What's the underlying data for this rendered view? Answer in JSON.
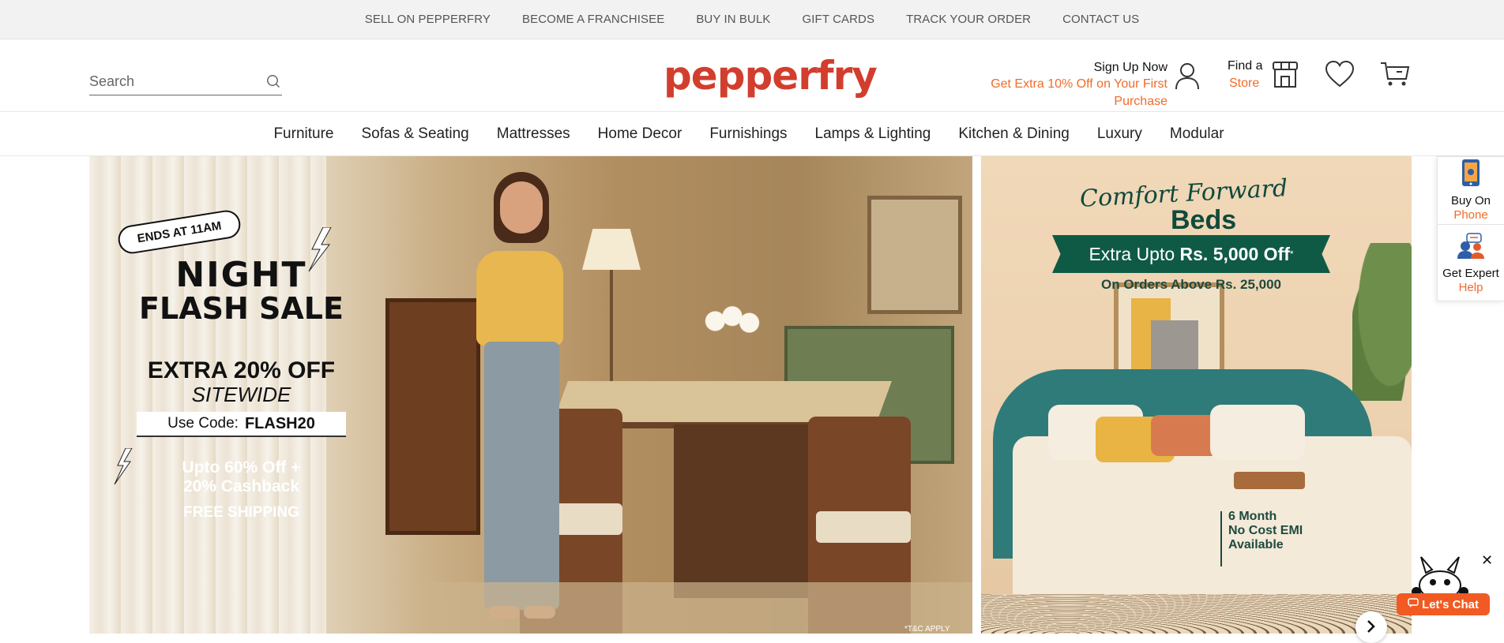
{
  "topbar": {
    "links": [
      "SELL ON PEPPERFRY",
      "BECOME A FRANCHISEE",
      "BUY IN BULK",
      "GIFT CARDS",
      "TRACK YOUR ORDER",
      "CONTACT US"
    ]
  },
  "header": {
    "search_placeholder": "Search",
    "logo": "pepperfry",
    "signup_title": "Sign Up Now",
    "signup_offer": "Get Extra 10% Off on Your First Purchase",
    "store_line1": "Find a",
    "store_line2": "Store"
  },
  "nav": {
    "items": [
      "Furniture",
      "Sofas & Seating",
      "Mattresses",
      "Home Decor",
      "Furnishings",
      "Lamps & Lighting",
      "Kitchen & Dining",
      "Luxury",
      "Modular"
    ]
  },
  "banner_left": {
    "badge": "ENDS AT 11AM",
    "title_line1": "NIGHT",
    "title_line2": "FLASH SALE",
    "offer": "EXTRA 20% OFF",
    "offer_sub": "SITEWIDE",
    "code_label": "Use Code:",
    "code": "FLASH20",
    "line1": "Upto 60% Off +",
    "line2": "20% Cashback",
    "shipping": "FREE SHIPPING",
    "tnc": "*T&C APPLY"
  },
  "banner_right": {
    "script": "Comfort Forward",
    "title": "Beds",
    "offer_prefix": "Extra Upto ",
    "offer_amount": "Rs. 5,000 Off",
    "offer_mark": "*",
    "condition": "On Orders Above Rs. 25,000",
    "emi_line1": "6 Month",
    "emi_line2": "No Cost EMI",
    "emi_line3": "Available"
  },
  "sidebar": {
    "buy_line1": "Buy On",
    "buy_line2": "Phone",
    "expert_line1": "Get Expert",
    "expert_line2": "Help"
  },
  "chat": {
    "label": "Let's Chat",
    "close": "✕"
  },
  "colors": {
    "brand": "#d23e2d",
    "accent": "#f16b28",
    "offer_green": "#0f5a45"
  }
}
